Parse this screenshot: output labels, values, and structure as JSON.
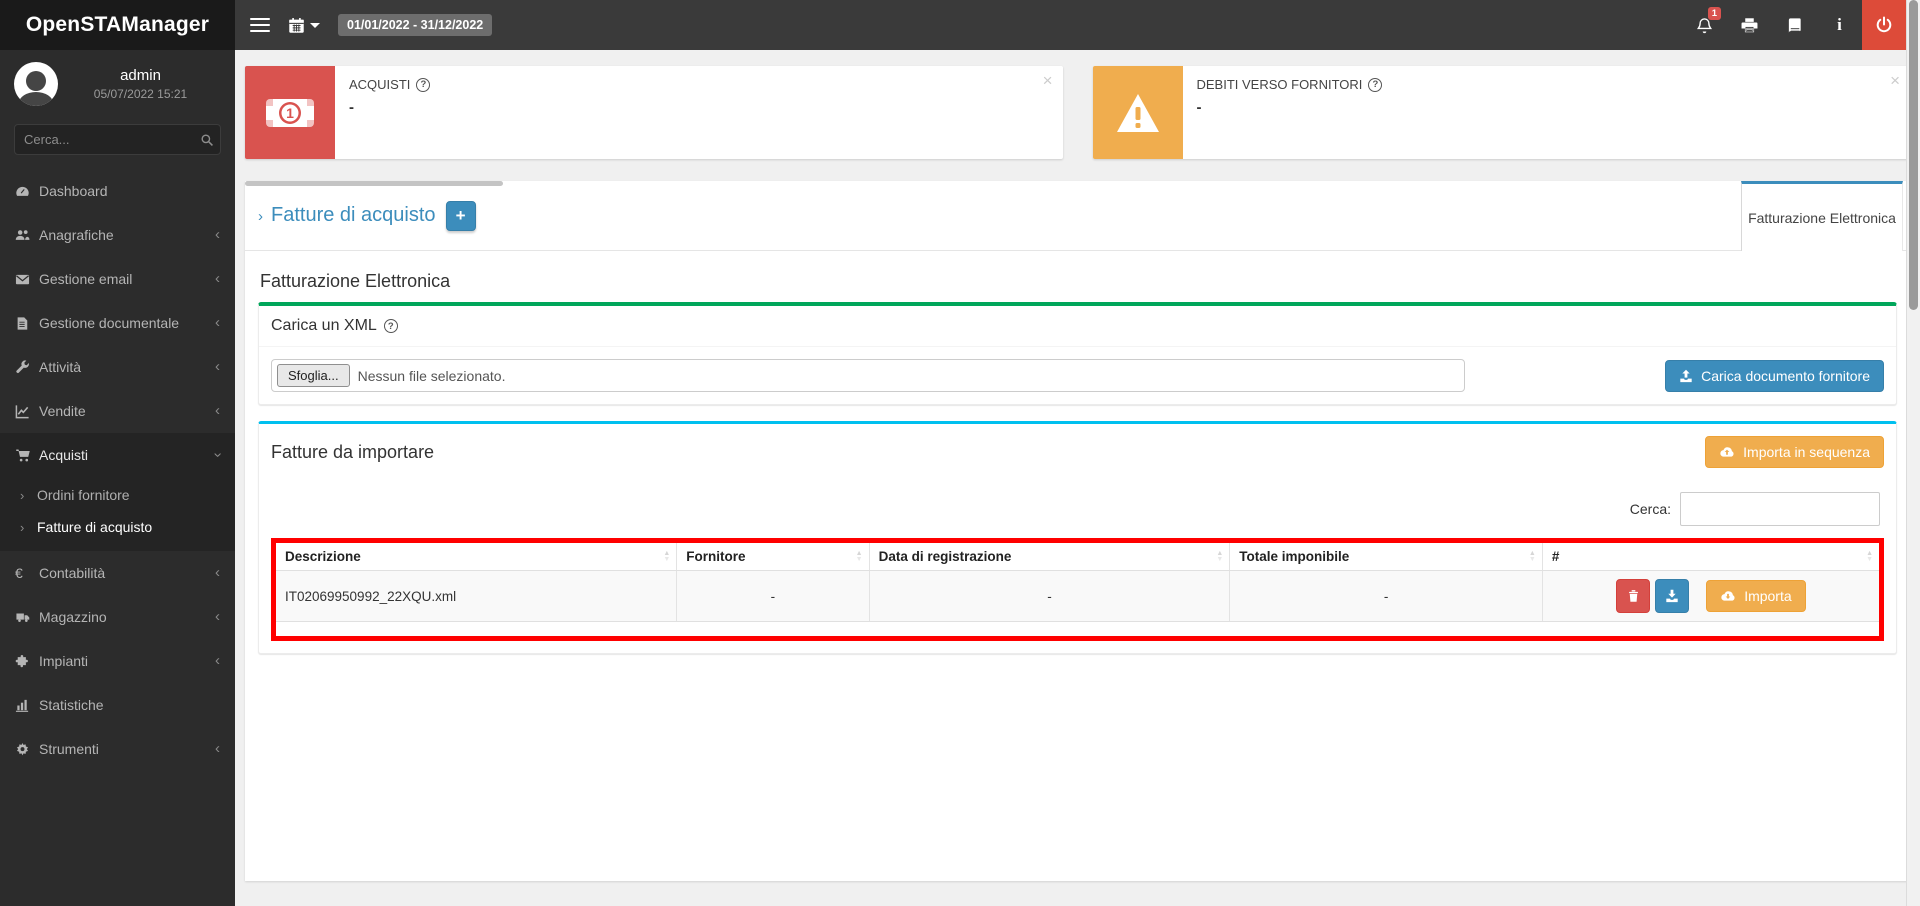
{
  "app": {
    "logo": "OpenSTAManager"
  },
  "navbar": {
    "date_range": "01/01/2022 - 31/12/2022",
    "notification_count": "1"
  },
  "sidebar": {
    "user": {
      "name": "admin",
      "login_datetime": "05/07/2022 15:21"
    },
    "search_placeholder": "Cerca...",
    "items": [
      {
        "label": "Dashboard"
      },
      {
        "label": "Anagrafiche"
      },
      {
        "label": "Gestione email"
      },
      {
        "label": "Gestione documentale"
      },
      {
        "label": "Attività"
      },
      {
        "label": "Vendite"
      },
      {
        "label": "Acquisti",
        "children": [
          {
            "label": "Ordini fornitore"
          },
          {
            "label": "Fatture di acquisto"
          }
        ]
      },
      {
        "label": "Contabilità"
      },
      {
        "label": "Magazzino"
      },
      {
        "label": "Impianti"
      },
      {
        "label": "Statistiche"
      },
      {
        "label": "Strumenti"
      }
    ]
  },
  "summary_cards": [
    {
      "label": "ACQUISTI",
      "value": "-",
      "color": "#d9534f"
    },
    {
      "label": "DEBITI VERSO FORNITORI",
      "value": "-",
      "color": "#f0ad4e"
    }
  ],
  "page": {
    "title": "Fatture di acquisto",
    "add_button_label": "+",
    "active_tab": "Fatturazione Elettronica",
    "section_heading": "Fatturazione Elettronica"
  },
  "upload_box": {
    "title": "Carica un XML",
    "browse_button": "Sfoglia...",
    "file_status": "Nessun file selezionato.",
    "submit_button": "Carica documento fornitore"
  },
  "import_box": {
    "title": "Fatture da importare",
    "bulk_button": "Importa in sequenza",
    "search_label": "Cerca:",
    "search_value": "",
    "table": {
      "headers": [
        "Descrizione",
        "Fornitore",
        "Data di registrazione",
        "Totale imponibile",
        "#"
      ],
      "rows": [
        {
          "descrizione": "IT02069950992_22XQU.xml",
          "fornitore": "-",
          "data_registrazione": "-",
          "totale_imponibile": "-",
          "import_button": "Importa"
        }
      ]
    }
  },
  "colors": {
    "accent_blue": "#3c8dbc",
    "success_green": "#00a65a",
    "info_cyan": "#00c0ef",
    "warning_orange": "#f0ad4e",
    "danger_red": "#d9534f",
    "logout_red": "#dd4b39",
    "highlight_border": "#ff0000"
  }
}
